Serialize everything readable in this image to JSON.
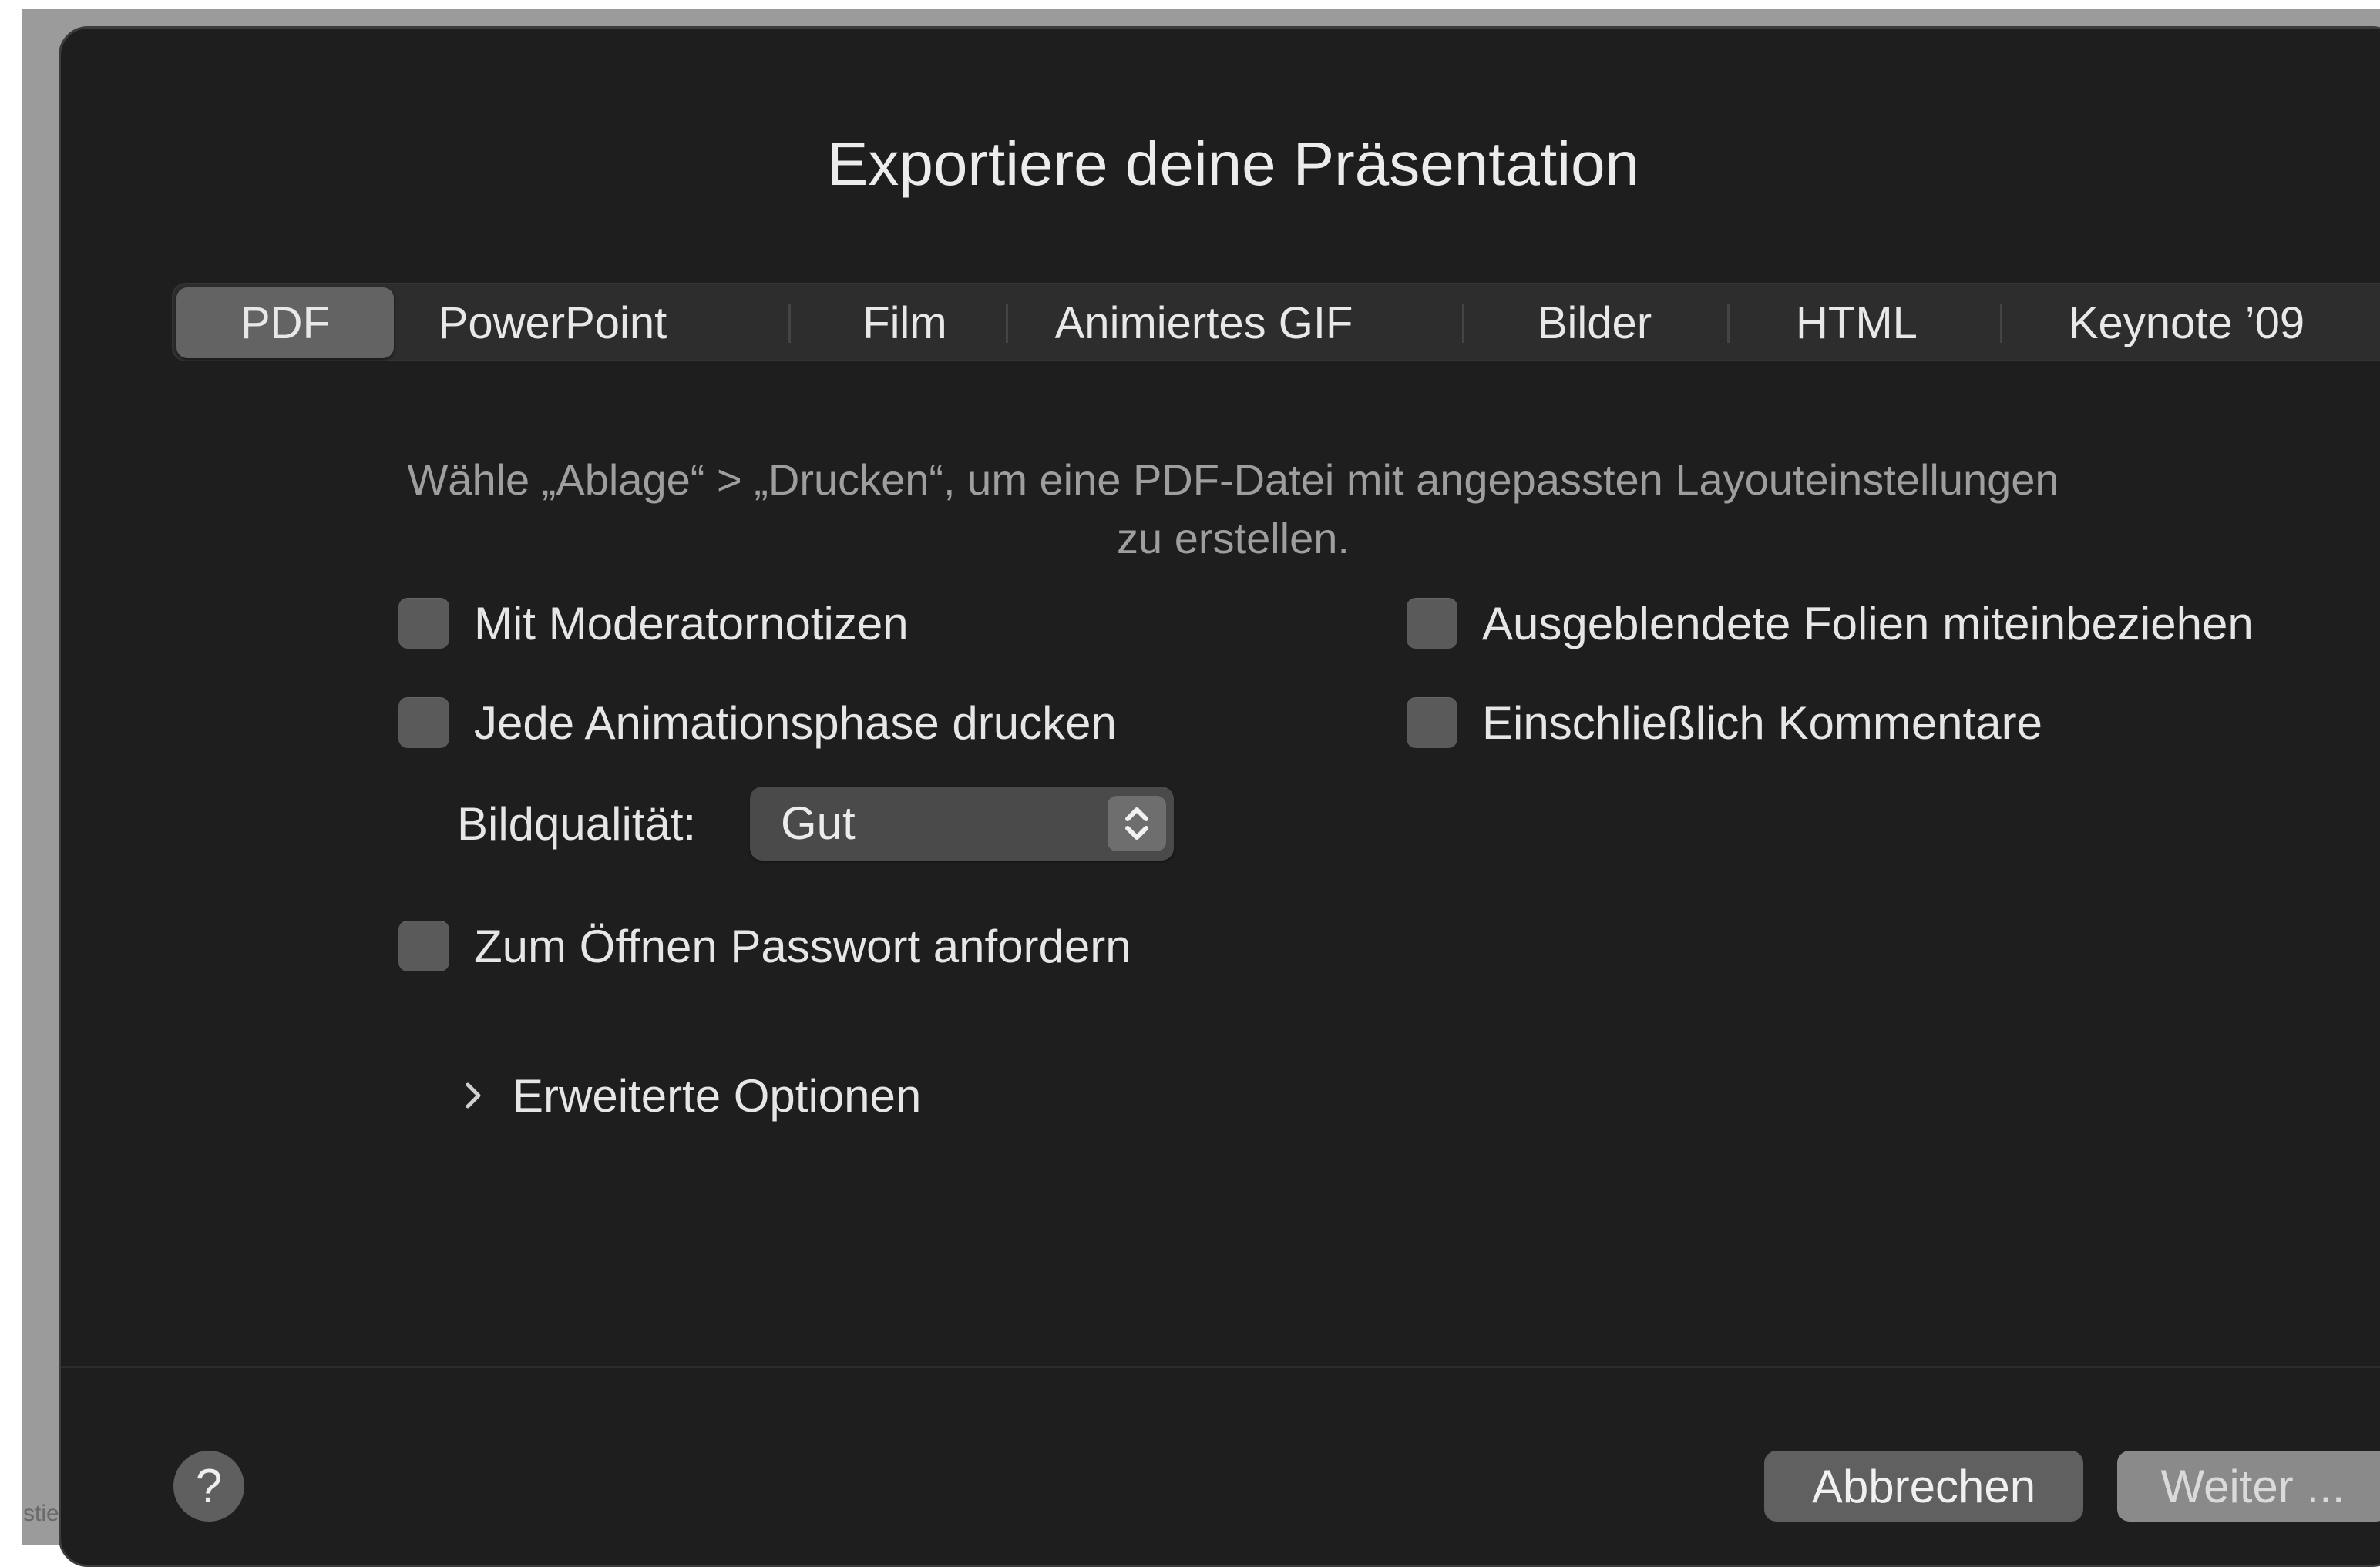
{
  "backdrop": {
    "edge_text": "stie"
  },
  "dialog": {
    "title": "Exportiere deine Präsentation",
    "tabs": [
      {
        "label": "PDF",
        "active": true
      },
      {
        "label": "PowerPoint",
        "active": false
      },
      {
        "label": "Film",
        "active": false
      },
      {
        "label": "Animiertes GIF",
        "active": false
      },
      {
        "label": "Bilder",
        "active": false
      },
      {
        "label": "HTML",
        "active": false
      },
      {
        "label": "Keynote ’09",
        "active": false
      }
    ],
    "info_line1": "Wähle „Ablage“ > „Drucken“, um eine PDF-Datei mit angepassten Layouteinstellungen",
    "info_line2": "zu erstellen.",
    "options": {
      "presenter_notes": {
        "label": "Mit Moderatornotizen",
        "checked": false
      },
      "hidden_slides": {
        "label": "Ausgeblendete Folien miteinbeziehen",
        "checked": false
      },
      "animation_phases": {
        "label": "Jede Animationsphase drucken",
        "checked": false
      },
      "comments": {
        "label": "Einschließlich Kommentare",
        "checked": false
      },
      "password": {
        "label": "Zum Öffnen Passwort anfordern",
        "checked": false
      }
    },
    "image_quality": {
      "label": "Bildqualität:",
      "value": "Gut"
    },
    "advanced_options": {
      "label": "Erweiterte Optionen",
      "expanded": false
    },
    "help_label": "?",
    "cancel_label": "Abbrechen",
    "next_label": "Weiter ..."
  },
  "icons": {
    "disclosure": "chevron-right-icon",
    "select_arrows": "chevron-up-down-icon"
  },
  "colors": {
    "dialog_bg": "#1e1e1e",
    "active_tab": "#636363",
    "checkbox": "#5a5a5a",
    "text_primary": "#e6e6e6",
    "text_secondary": "#9e9e9e"
  }
}
